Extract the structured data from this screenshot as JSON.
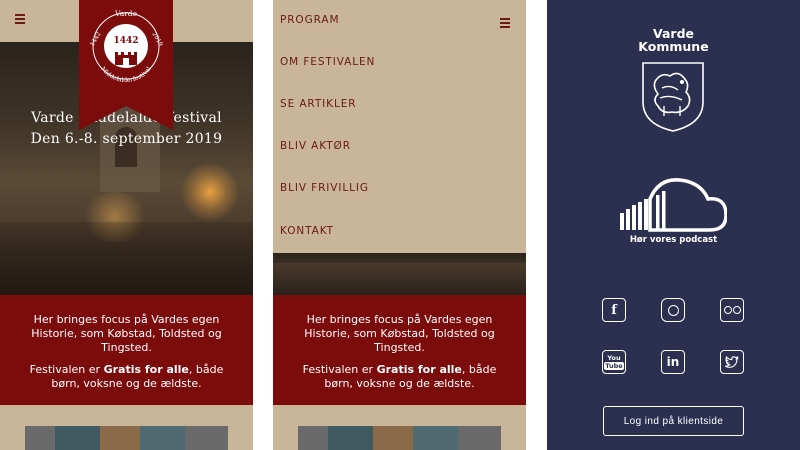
{
  "festival": {
    "banner_top": "Varde",
    "banner_year": "1442",
    "banner_left": "1442",
    "banner_right": "2019",
    "banner_arc": "Middelalderfestival",
    "hero_line1": "Varde Middelalderfestival",
    "hero_line2": "Den 6.-8. september 2019",
    "intro_text": "Her bringes focus på Vardes egen Historie, som Købstad, Toldsted og Tingsted.",
    "intro_pre": "Festivalen er ",
    "intro_bold": "Gratis for alle",
    "intro_post": ", både børn, voksne og de ældste."
  },
  "menu": {
    "items": [
      "PROGRAM",
      "OM FESTIVALEN",
      "SE ARTIKLER",
      "BLIV AKTØR",
      "BLIV FRIVILLIG",
      "KONTAKT"
    ]
  },
  "footer": {
    "kommune_line1": "Varde",
    "kommune_line2": "Kommune",
    "podcast_label": "Hør vores podcast",
    "social_icons": [
      "facebook-icon",
      "instagram-icon",
      "flickr-icon",
      "youtube-icon",
      "linkedin-icon",
      "twitter-icon"
    ],
    "youtube_top": "You",
    "youtube_bottom": "Tube",
    "linkedin_text": "in",
    "facebook_text": "f",
    "login_label": "Log ind på klientside"
  },
  "colors": {
    "parchment": "#c8b59a",
    "burgundy": "#7c0b0b",
    "navy": "#2c3050",
    "menu_text": "#6b1a14"
  }
}
